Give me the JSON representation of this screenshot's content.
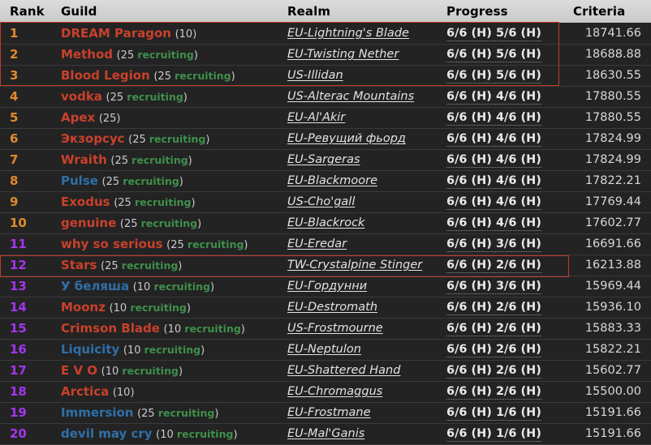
{
  "table": {
    "columns": [
      "Rank",
      "Guild",
      "Realm",
      "Progress",
      "Criteria"
    ],
    "colors": {
      "header_bg": "#d2d2d2",
      "row_bg": "#232323",
      "rank_orange": "#e08a2e",
      "rank_purple": "#a335ee",
      "guild_horde": "#c8412b",
      "guild_alliance": "#2f6fa8",
      "recruiting_green": "#3f8f4a",
      "selection_red": "#c0392b"
    },
    "rows": [
      {
        "rank": "1",
        "rank_color": "orange",
        "guild": "DREAM Paragon",
        "faction": "horde",
        "size": "(10)",
        "realm": "EU-Lightning's Blade",
        "progress": "6/6 (H) 5/6 (H)",
        "criteria": "18741.66"
      },
      {
        "rank": "2",
        "rank_color": "orange",
        "guild": "Method",
        "faction": "horde",
        "size": "(25 recruiting)",
        "realm": "EU-Twisting Nether",
        "progress": "6/6 (H) 5/6 (H)",
        "criteria": "18688.88"
      },
      {
        "rank": "3",
        "rank_color": "orange",
        "guild": "Blood Legion",
        "faction": "horde",
        "size": "(25 recruiting)",
        "realm": "US-Illidan",
        "progress": "6/6 (H) 5/6 (H)",
        "criteria": "18630.55"
      },
      {
        "rank": "4",
        "rank_color": "orange",
        "guild": "vodka",
        "faction": "horde",
        "size": "(25 recruiting)",
        "realm": "US-Alterac Mountains",
        "progress": "6/6 (H) 4/6 (H)",
        "criteria": "17880.55"
      },
      {
        "rank": "5",
        "rank_color": "orange",
        "guild": "Apex",
        "faction": "horde",
        "size": "(25)",
        "realm": "EU-Al'Akir",
        "progress": "6/6 (H) 4/6 (H)",
        "criteria": "17880.55"
      },
      {
        "rank": "6",
        "rank_color": "orange",
        "guild": "Экзорсус",
        "faction": "horde",
        "size": "(25 recruiting)",
        "realm": "EU-Ревущий фьорд",
        "progress": "6/6 (H) 4/6 (H)",
        "criteria": "17824.99"
      },
      {
        "rank": "7",
        "rank_color": "orange",
        "guild": "Wraith",
        "faction": "horde",
        "size": "(25 recruiting)",
        "realm": "EU-Sargeras",
        "progress": "6/6 (H) 4/6 (H)",
        "criteria": "17824.99"
      },
      {
        "rank": "8",
        "rank_color": "orange",
        "guild": "Pulse",
        "faction": "alliance",
        "size": "(25 recruiting)",
        "realm": "EU-Blackmoore",
        "progress": "6/6 (H) 4/6 (H)",
        "criteria": "17822.21"
      },
      {
        "rank": "9",
        "rank_color": "orange",
        "guild": "Exodus",
        "faction": "horde",
        "size": "(25 recruiting)",
        "realm": "US-Cho'gall",
        "progress": "6/6 (H) 4/6 (H)",
        "criteria": "17769.44"
      },
      {
        "rank": "10",
        "rank_color": "orange",
        "guild": "genuine",
        "faction": "horde",
        "size": "(25 recruiting)",
        "realm": "EU-Blackrock",
        "progress": "6/6 (H) 4/6 (H)",
        "criteria": "17602.77"
      },
      {
        "rank": "11",
        "rank_color": "purple",
        "guild": "why so serious",
        "faction": "horde",
        "size": "(25 recruiting)",
        "realm": "EU-Eredar",
        "progress": "6/6 (H) 3/6 (H)",
        "criteria": "16691.66"
      },
      {
        "rank": "12",
        "rank_color": "purple",
        "guild": "Stars",
        "faction": "horde",
        "size": "(25 recruiting)",
        "realm": "TW-Crystalpine Stinger",
        "progress": "6/6 (H) 2/6 (H)",
        "criteria": "16213.88"
      },
      {
        "rank": "13",
        "rank_color": "purple",
        "guild": "У беляша",
        "faction": "alliance",
        "size": "(10 recruiting)",
        "realm": "EU-Гордунни",
        "progress": "6/6 (H) 3/6 (H)",
        "criteria": "15969.44"
      },
      {
        "rank": "14",
        "rank_color": "purple",
        "guild": "Moonz",
        "faction": "horde",
        "size": "(10 recruiting)",
        "realm": "EU-Destromath",
        "progress": "6/6 (H) 2/6 (H)",
        "criteria": "15936.10"
      },
      {
        "rank": "15",
        "rank_color": "purple",
        "guild": "Crimson Blade",
        "faction": "horde",
        "size": "(10 recruiting)",
        "realm": "US-Frostmourne",
        "progress": "6/6 (H) 2/6 (H)",
        "criteria": "15883.33"
      },
      {
        "rank": "16",
        "rank_color": "purple",
        "guild": "Liquicity",
        "faction": "alliance",
        "size": "(10 recruiting)",
        "realm": "EU-Neptulon",
        "progress": "6/6 (H) 2/6 (H)",
        "criteria": "15822.21"
      },
      {
        "rank": "17",
        "rank_color": "purple",
        "guild": "E V O",
        "faction": "horde",
        "size": "(10 recruiting)",
        "realm": "EU-Shattered Hand",
        "progress": "6/6 (H) 2/6 (H)",
        "criteria": "15602.77"
      },
      {
        "rank": "18",
        "rank_color": "purple",
        "guild": "Arctica",
        "faction": "horde",
        "size": "(10)",
        "realm": "EU-Chromaggus",
        "progress": "6/6 (H) 2/6 (H)",
        "criteria": "15500.00"
      },
      {
        "rank": "19",
        "rank_color": "purple",
        "guild": "Immersion",
        "faction": "alliance",
        "size": "(25 recruiting)",
        "realm": "EU-Frostmane",
        "progress": "6/6 (H) 1/6 (H)",
        "criteria": "15191.66"
      },
      {
        "rank": "20",
        "rank_color": "purple",
        "guild": "devil may cry",
        "faction": "alliance",
        "size": "(10 recruiting)",
        "realm": "EU-Mal'Ganis",
        "progress": "6/6 (H) 1/6 (H)",
        "criteria": "15191.66"
      }
    ]
  }
}
